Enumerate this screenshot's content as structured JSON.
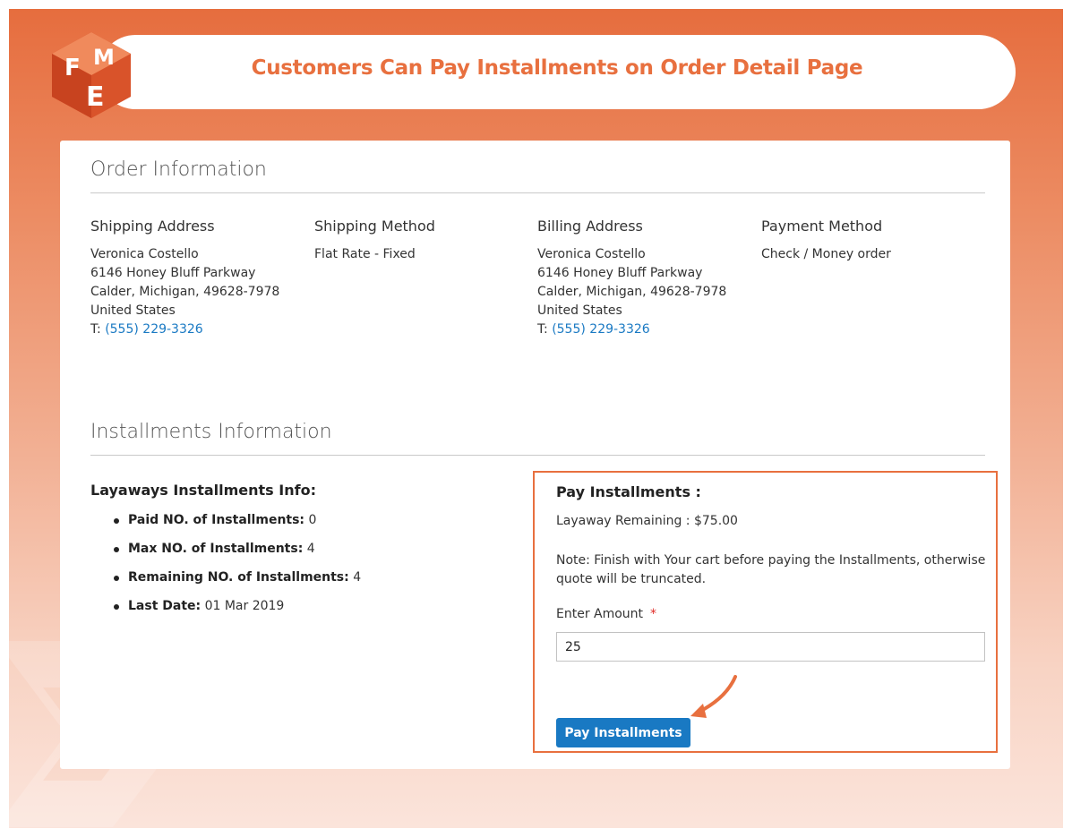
{
  "banner": {
    "title": "Customers Can Pay Installments on Order Detail Page",
    "logo_letters": [
      "F",
      "M",
      "E"
    ]
  },
  "order_info": {
    "section_title": "Order Information",
    "columns": [
      {
        "heading": "Shipping Address",
        "lines": [
          "Veronica Costello",
          "6146 Honey Bluff Parkway",
          "Calder, Michigan, 49628-7978",
          "United States"
        ],
        "phone_prefix": "T:",
        "phone": "(555) 229-3326"
      },
      {
        "heading": "Shipping Method",
        "lines": [
          "Flat Rate - Fixed"
        ]
      },
      {
        "heading": "Billing Address",
        "lines": [
          "Veronica Costello",
          "6146 Honey Bluff Parkway",
          "Calder, Michigan, 49628-7978",
          "United States"
        ],
        "phone_prefix": "T:",
        "phone": "(555) 229-3326"
      },
      {
        "heading": "Payment Method",
        "lines": [
          "Check / Money order"
        ]
      }
    ]
  },
  "installments": {
    "section_title": "Installments Information",
    "layaway_heading": "Layaways Installments Info:",
    "items": [
      {
        "label": "Paid NO. of Installments:",
        "value": "0"
      },
      {
        "label": "Max NO. of Installments:",
        "value": "4"
      },
      {
        "label": "Remaining NO. of Installments:",
        "value": "4"
      },
      {
        "label": "Last Date:",
        "value": "01 Mar 2019"
      }
    ]
  },
  "pay_form": {
    "heading": "Pay Installments :",
    "remaining": "Layaway Remaining : $75.00",
    "note": "Note: Finish with Your cart before paying the Installments, otherwise quote will be truncated.",
    "amount_label": "Enter Amount",
    "required_mark": "*",
    "amount_value": "25",
    "button_label": "Pay Installments"
  },
  "colors": {
    "accent": "#e8703f",
    "link": "#1979c3",
    "button": "#1979c3"
  },
  "icons": [
    "fme-logo-icon",
    "arrow-pointer-icon"
  ]
}
